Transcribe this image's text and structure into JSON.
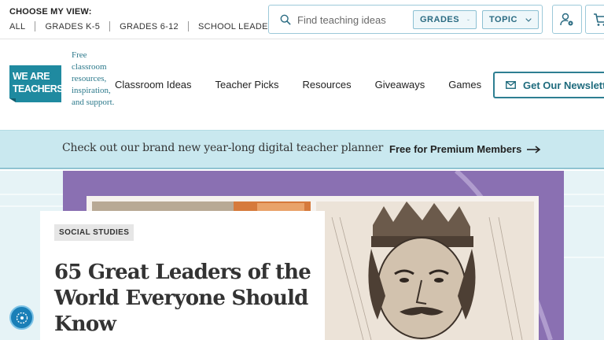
{
  "topbar": {
    "choose_label": "CHOOSE MY VIEW:",
    "grade_links": [
      "ALL",
      "GRADES K-5",
      "GRADES 6-12",
      "SCHOOL LEADERS"
    ],
    "search": {
      "placeholder": "Find teaching ideas",
      "value": ""
    },
    "grades_dropdown": "GRADES",
    "topic_dropdown": "TOPIC"
  },
  "logo": {
    "line1": "WE ARE",
    "line2": "TEACHERS"
  },
  "tagline": "Free classroom resources, inspiration, and support.",
  "nav": {
    "items": [
      "Classroom Ideas",
      "Teacher Picks",
      "Resources",
      "Giveaways",
      "Games"
    ],
    "newsletter": "Get Our Newsletter"
  },
  "promo": {
    "text": "Check out our brand new year-long digital teacher planner",
    "link": "Free for Premium Members"
  },
  "article": {
    "category": "SOCIAL STUDIES",
    "title": "65 Great Leaders of the World Everyone Should Know"
  },
  "colors": {
    "accent_teal": "#2e7f92",
    "promo_bg": "#c9e8ef",
    "hero_purple": "#8a70b2",
    "logo_teal": "#1f8aa0"
  },
  "icons": {
    "search": "search-icon",
    "account": "account-settings-icon",
    "cart": "cart-icon",
    "newsletter": "envelope-icon",
    "promo_arrow": "arrow-right-icon",
    "help": "help-bubble-icon"
  }
}
